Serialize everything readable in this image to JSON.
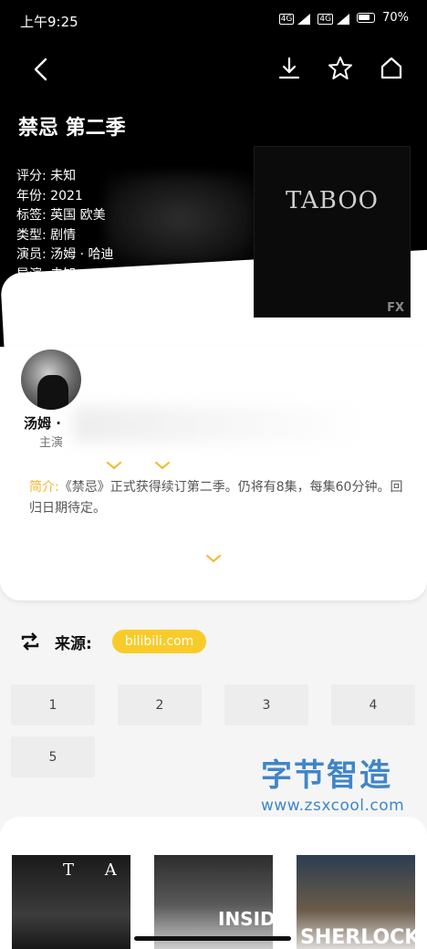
{
  "status": {
    "time": "上午9:25",
    "network1": "4G",
    "network2": "4G",
    "battery": "70%"
  },
  "show": {
    "title": "禁忌 第二季",
    "meta": [
      {
        "label": "评分",
        "value": "未知"
      },
      {
        "label": "年份",
        "value": "2021"
      },
      {
        "label": "标签",
        "value": "英国 欧美"
      },
      {
        "label": "类型",
        "value": "剧情"
      },
      {
        "label": "演员",
        "value": "汤姆 · 哈迪"
      },
      {
        "label": "导演",
        "value": "未知"
      }
    ],
    "poster_title": "TABOO",
    "poster_badge": "FX"
  },
  "cast": {
    "name": "汤姆 ·",
    "role": "主演"
  },
  "synopsis": {
    "label": "简介:",
    "text": "《禁忌》正式获得续订第二季。仍将有8集，每集60分钟。回归日期待定。"
  },
  "source": {
    "label": "来源:",
    "value": "bilibili.com"
  },
  "episodes": [
    "1",
    "2",
    "3",
    "4",
    "5"
  ],
  "watermark": {
    "cn": "字节智造",
    "url": "www.zsxcool.com"
  },
  "recommendations": [
    {
      "text": "T A"
    },
    {
      "text": "INSIDE"
    },
    {
      "text": "SHERLOCK"
    }
  ],
  "colors": {
    "accent": "#f9cb2a",
    "synopsis_label": "#f2b72c",
    "watermark": "#3f86c9"
  }
}
